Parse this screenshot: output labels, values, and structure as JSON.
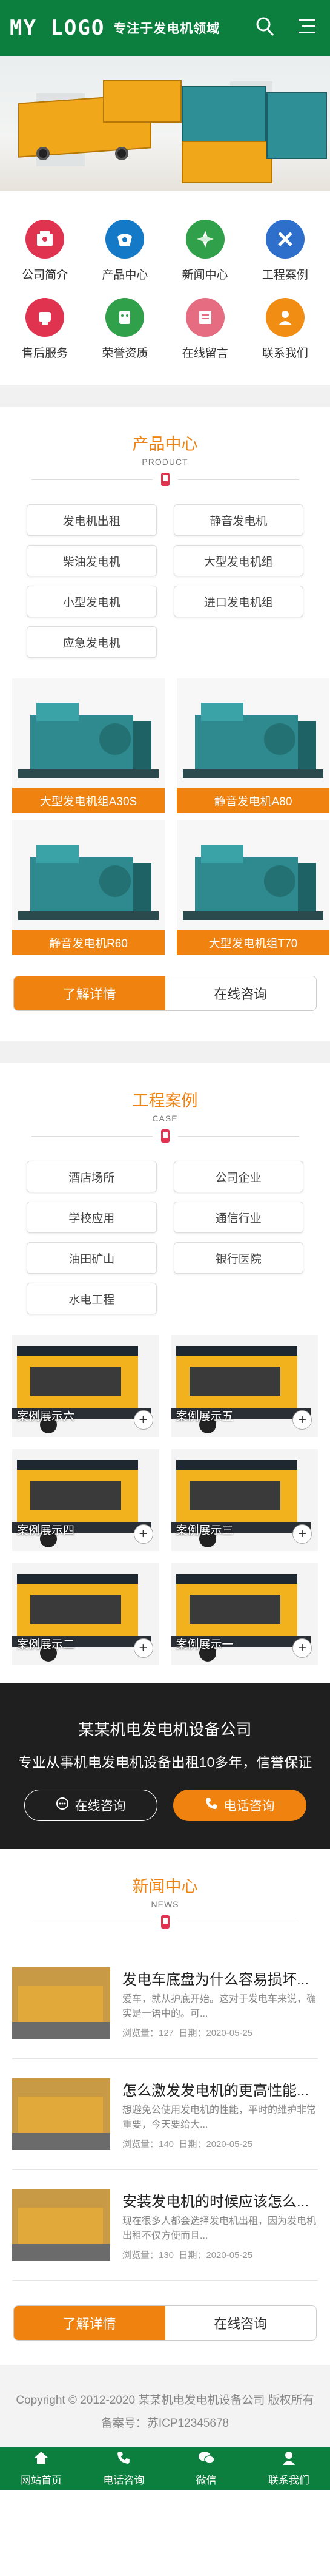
{
  "header": {
    "logo": "MY LOGO",
    "slogan": "专注于发电机领域",
    "search_icon": "search-icon",
    "menu_icon": "menu-icon"
  },
  "nav": [
    {
      "label": "公司简介",
      "icon": "company-icon",
      "color": "#e0334f"
    },
    {
      "label": "产品中心",
      "icon": "product-icon",
      "color": "#1479c7"
    },
    {
      "label": "新闻中心",
      "icon": "news-icon",
      "color": "#31a04a"
    },
    {
      "label": "工程案例",
      "icon": "tools-icon",
      "color": "#2d6fca"
    },
    {
      "label": "售后服务",
      "icon": "service-icon",
      "color": "#e0334f"
    },
    {
      "label": "荣誉资质",
      "icon": "honor-icon",
      "color": "#31a04a"
    },
    {
      "label": "在线留言",
      "icon": "message-icon",
      "color": "#e66c82"
    },
    {
      "label": "联系我们",
      "icon": "contact-icon",
      "color": "#f08d12"
    }
  ],
  "products": {
    "title": "产品中心",
    "subtitle": "PRODUCT",
    "categories": [
      "发电机出租",
      "静音发电机",
      "柴油发电机",
      "大型发电机组",
      "小型发电机",
      "进口发电机组",
      "应急发电机"
    ],
    "items": [
      "大型发电机组A30S",
      "静音发电机A80",
      "静音发电机R60",
      "大型发电机组T70"
    ],
    "more_label": "了解详情",
    "consult_label": "在线咨询"
  },
  "cases": {
    "title": "工程案例",
    "subtitle": "CASE",
    "categories": [
      "酒店场所",
      "公司企业",
      "学校应用",
      "通信行业",
      "油田矿山",
      "银行医院",
      "水电工程"
    ],
    "items": [
      "案例展示六",
      "案例展示五",
      "案例展示四",
      "案例展示三",
      "案例展示二",
      "案例展示一"
    ]
  },
  "promo": {
    "title": "某某机电发电机设备公司",
    "desc": "专业从事机电发电机设备出租10多年，信誉保证",
    "consult_label": "在线咨询",
    "phone_label": "电话咨询"
  },
  "news": {
    "title": "新闻中心",
    "subtitle": "NEWS",
    "items": [
      {
        "title": "发电车底盘为什么容易损坏...",
        "summary": "爱车，就从护底开始。这对于发电车来说，确实是一语中的。可...",
        "views": "浏览量：127",
        "date": "日期：2020-05-25"
      },
      {
        "title": "怎么激发发电机的更高性能...",
        "summary": "想避免公使用发电机的性能，平时的维护非常重要，今天要给大...",
        "views": "浏览量：140",
        "date": "日期：2020-05-25"
      },
      {
        "title": "安装发电机的时候应该怎么...",
        "summary": "现在很多人都会选择发电机出租，因为发电机出租不仅方便而且...",
        "views": "浏览量：130",
        "date": "日期：2020-05-25"
      }
    ],
    "more_label": "了解详情",
    "consult_label": "在线咨询"
  },
  "footer": {
    "copyright": "Copyright © 2012-2020 某某机电发电机设备公司 版权所有",
    "icp": "备案号：苏ICP12345678"
  },
  "bottom_nav": [
    {
      "label": "网站首页",
      "icon": "home-icon"
    },
    {
      "label": "电话咨询",
      "icon": "phone-icon"
    },
    {
      "label": "微信",
      "icon": "wechat-icon"
    },
    {
      "label": "联系我们",
      "icon": "user-icon"
    }
  ],
  "colors": {
    "brand": "#0c7f3e",
    "accent": "#f0820f"
  }
}
